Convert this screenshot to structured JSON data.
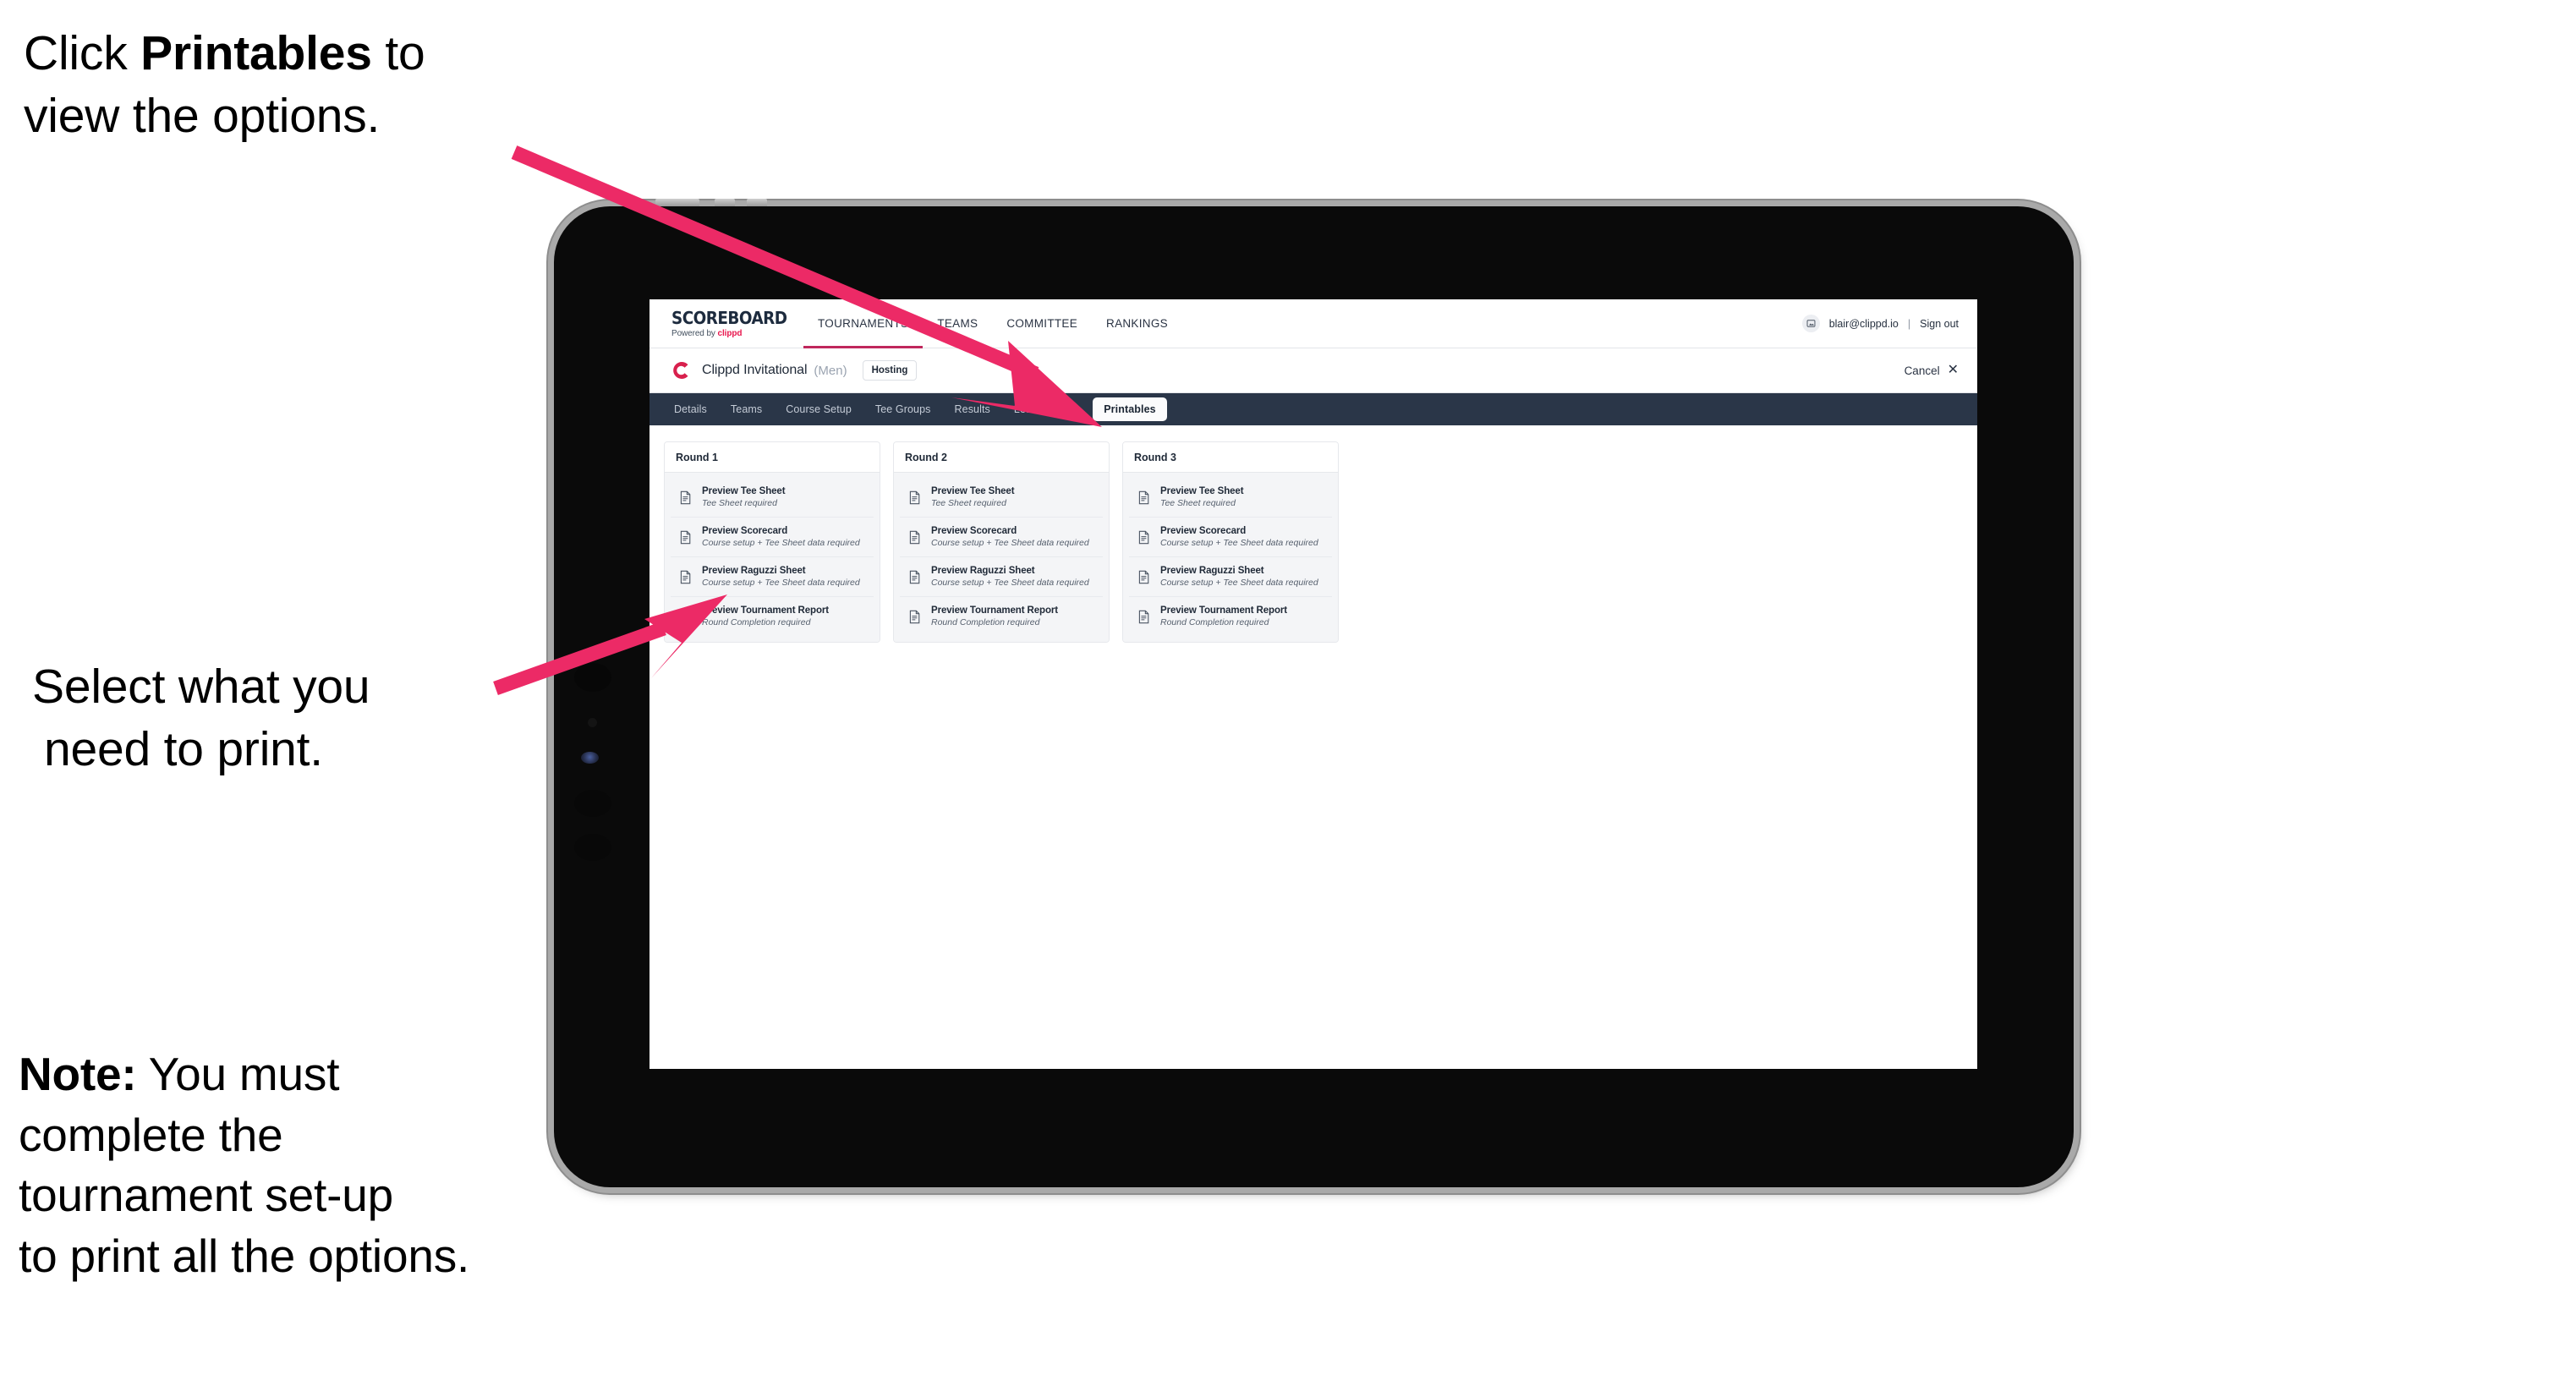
{
  "annotations": {
    "callout_1": {
      "prefix": "Click ",
      "bold": "Printables",
      "suffix": " to",
      "line2": "view the options."
    },
    "callout_2": {
      "line1": "Select what you",
      "line2": "need to print."
    },
    "callout_3": {
      "label": "Note:",
      "line1": " You must",
      "line2": "complete the",
      "line3": "tournament set-up",
      "line4": "to print all the options."
    },
    "arrow_color": "#ec2a66"
  },
  "app": {
    "brand": {
      "title": "SCOREBOARD",
      "powered_prefix": "Powered by ",
      "powered_brand": "clippd"
    },
    "nav": [
      {
        "label": "TOURNAMENTS",
        "active": true
      },
      {
        "label": "TEAMS",
        "active": false
      },
      {
        "label": "COMMITTEE",
        "active": false
      },
      {
        "label": "RANKINGS",
        "active": false
      }
    ],
    "account": {
      "avatar_icon": "user-avatar-icon",
      "email": "blair@clippd.io",
      "separator": "|",
      "sign_out": "Sign out"
    },
    "tournament": {
      "logo_icon": "clippd-c-logo",
      "name": "Clippd Invitational",
      "gender": "(Men)",
      "status_badge": "Hosting",
      "cancel_label": "Cancel",
      "cancel_icon": "close-x-icon"
    },
    "section_tabs": [
      {
        "label": "Details",
        "active": false
      },
      {
        "label": "Teams",
        "active": false
      },
      {
        "label": "Course Setup",
        "active": false
      },
      {
        "label": "Tee Groups",
        "active": false
      },
      {
        "label": "Results",
        "active": false
      },
      {
        "label": "Leaderboards",
        "active": false
      },
      {
        "label": "Printables",
        "active": true
      }
    ],
    "rounds": [
      {
        "title": "Round 1",
        "items": [
          {
            "title": "Preview Tee Sheet",
            "subtitle": "Tee Sheet required"
          },
          {
            "title": "Preview Scorecard",
            "subtitle": "Course setup + Tee Sheet data required"
          },
          {
            "title": "Preview Raguzzi Sheet",
            "subtitle": "Course setup + Tee Sheet data required"
          },
          {
            "title": "Preview Tournament Report",
            "subtitle": "Round Completion required"
          }
        ]
      },
      {
        "title": "Round 2",
        "items": [
          {
            "title": "Preview Tee Sheet",
            "subtitle": "Tee Sheet required"
          },
          {
            "title": "Preview Scorecard",
            "subtitle": "Course setup + Tee Sheet data required"
          },
          {
            "title": "Preview Raguzzi Sheet",
            "subtitle": "Course setup + Tee Sheet data required"
          },
          {
            "title": "Preview Tournament Report",
            "subtitle": "Round Completion required"
          }
        ]
      },
      {
        "title": "Round 3",
        "items": [
          {
            "title": "Preview Tee Sheet",
            "subtitle": "Tee Sheet required"
          },
          {
            "title": "Preview Scorecard",
            "subtitle": "Course setup + Tee Sheet data required"
          },
          {
            "title": "Preview Raguzzi Sheet",
            "subtitle": "Course setup + Tee Sheet data required"
          },
          {
            "title": "Preview Tournament Report",
            "subtitle": "Round Completion required"
          }
        ]
      }
    ]
  },
  "colors": {
    "accent_pink": "#e8174e",
    "nav_underline": "#c0275c",
    "section_bar": "#2a3648",
    "text_dark": "#1f2937"
  }
}
